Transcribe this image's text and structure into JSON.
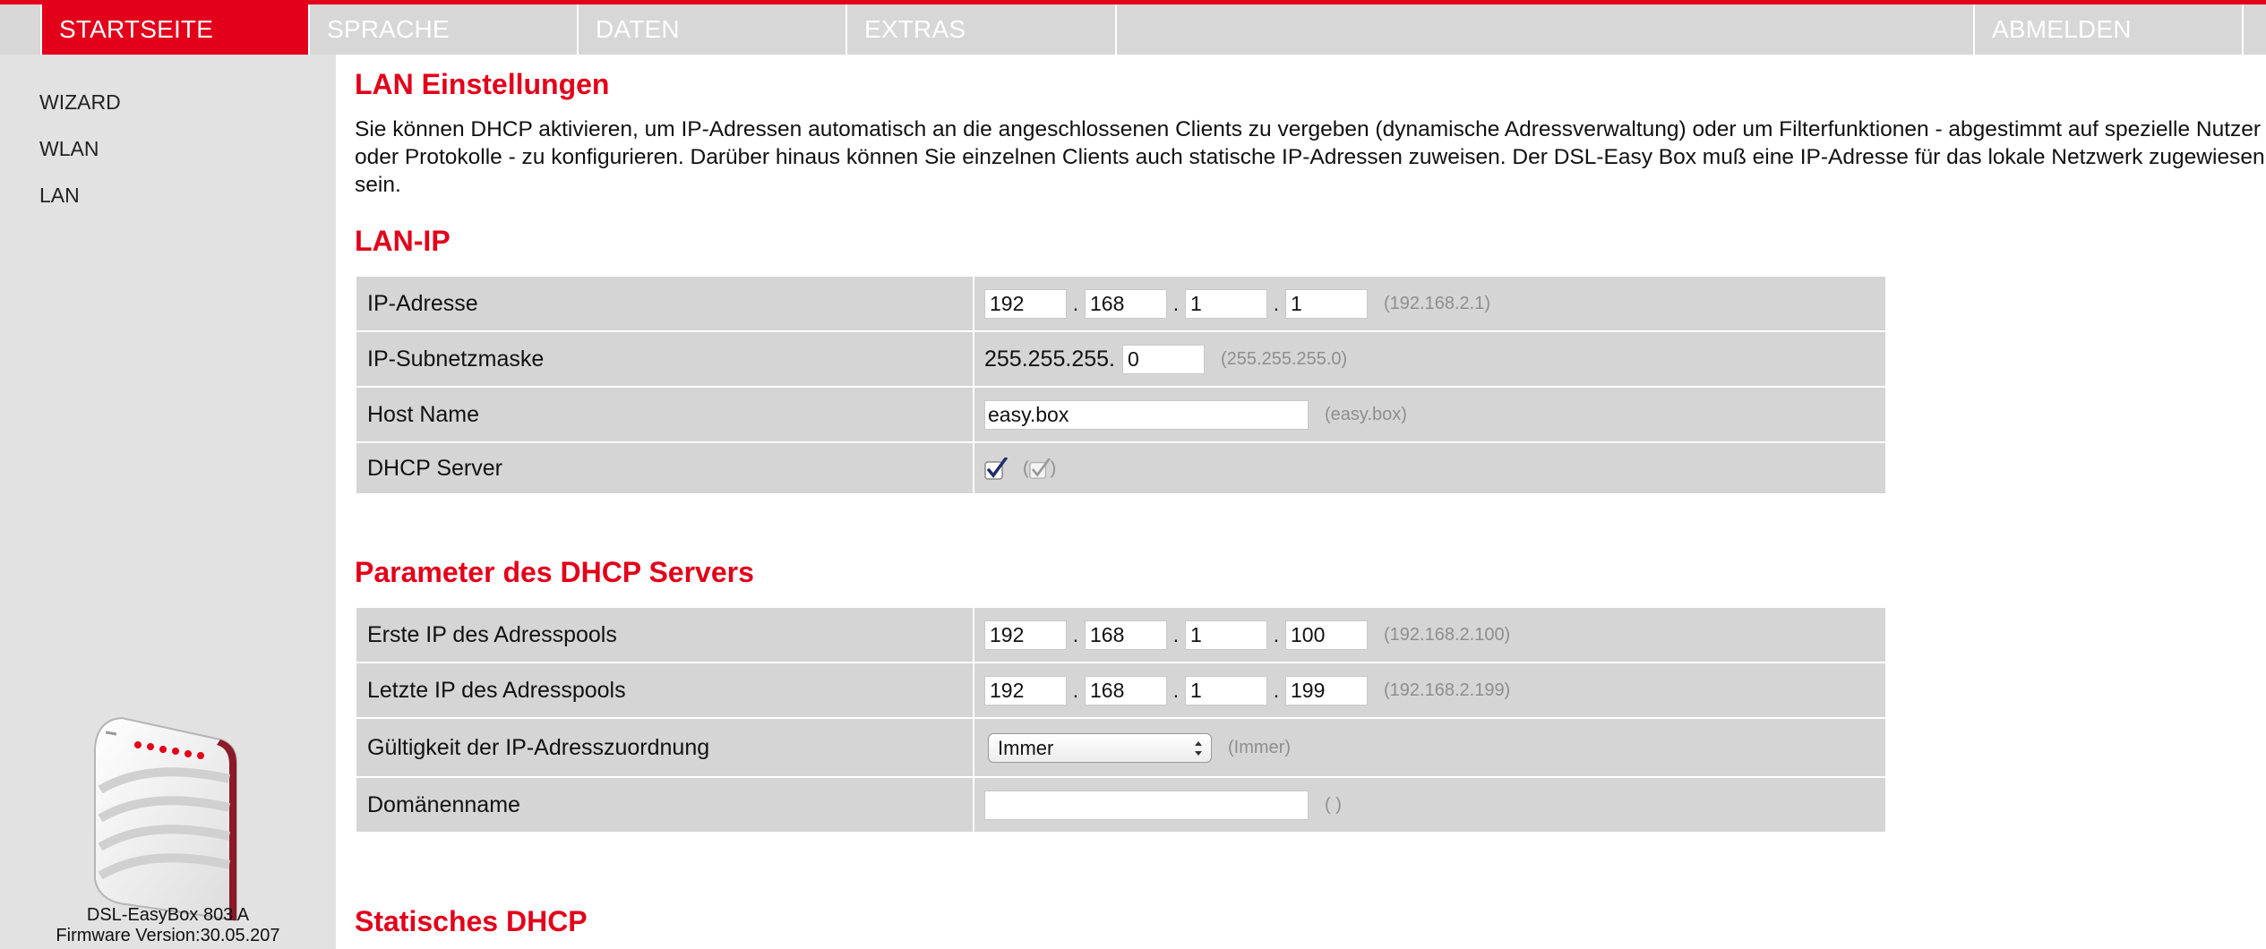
{
  "nav": {
    "tabs": [
      {
        "label": "STARTSEITE",
        "active": true
      },
      {
        "label": "SPRACHE"
      },
      {
        "label": "DATEN"
      },
      {
        "label": "EXTRAS"
      }
    ],
    "logout_label": "ABMELDEN"
  },
  "sidebar": {
    "items": [
      {
        "label": "WIZARD"
      },
      {
        "label": "WLAN"
      },
      {
        "label": "LAN"
      }
    ],
    "device_name": "DSL-EasyBox 803 A",
    "firmware": "Firmware Version:30.05.207"
  },
  "main": {
    "title": "LAN Einstellungen",
    "intro": "Sie können DHCP aktivieren, um IP-Adressen automatisch an die angeschlossenen Clients zu vergeben (dynamische Adressverwaltung) oder um Filterfunktionen - abgestimmt auf spezielle Nutzer oder Protokolle - zu konfigurieren. Darüber hinaus können Sie einzelnen Clients auch statische IP-Adressen zuweisen. Der DSL-Easy Box muß eine IP-Adresse für das lokale Netzwerk zugewiesen sein.",
    "lan_ip": {
      "heading": "LAN-IP",
      "ip_label": "IP-Adresse",
      "ip": [
        "192",
        "168",
        "1",
        "1"
      ],
      "ip_default": "(192.168.2.1)",
      "subnet_label": "IP-Subnetzmaske",
      "subnet_prefix": "255.255.255.",
      "subnet_last": "0",
      "subnet_default": "(255.255.255.0)",
      "host_label": "Host Name",
      "host_value": "easy.box",
      "host_default": "(easy.box)",
      "dhcp_label": "DHCP Server",
      "dhcp_checked": true
    },
    "dhcp_params": {
      "heading": "Parameter des DHCP Servers",
      "first_label": "Erste IP des Adresspools",
      "first_ip": [
        "192",
        "168",
        "1",
        "100"
      ],
      "first_default": "(192.168.2.100)",
      "last_label": "Letzte IP des Adresspools",
      "last_ip": [
        "192",
        "168",
        "1",
        "199"
      ],
      "last_default": "(192.168.2.199)",
      "lease_label": "Gültigkeit der IP-Adresszuordnung",
      "lease_value": "Immer",
      "lease_default": "(Immer)",
      "domain_label": "Domänenname",
      "domain_value": "",
      "domain_default": "( )"
    },
    "static_dhcp": {
      "heading": "Statisches DHCP"
    }
  },
  "colors": {
    "accent": "#e2001a",
    "nav_bg": "#d7d7d7",
    "sidebar_bg": "#e2e2e2",
    "row_bg": "#d5d5d5",
    "hint": "#8e8e8e"
  }
}
